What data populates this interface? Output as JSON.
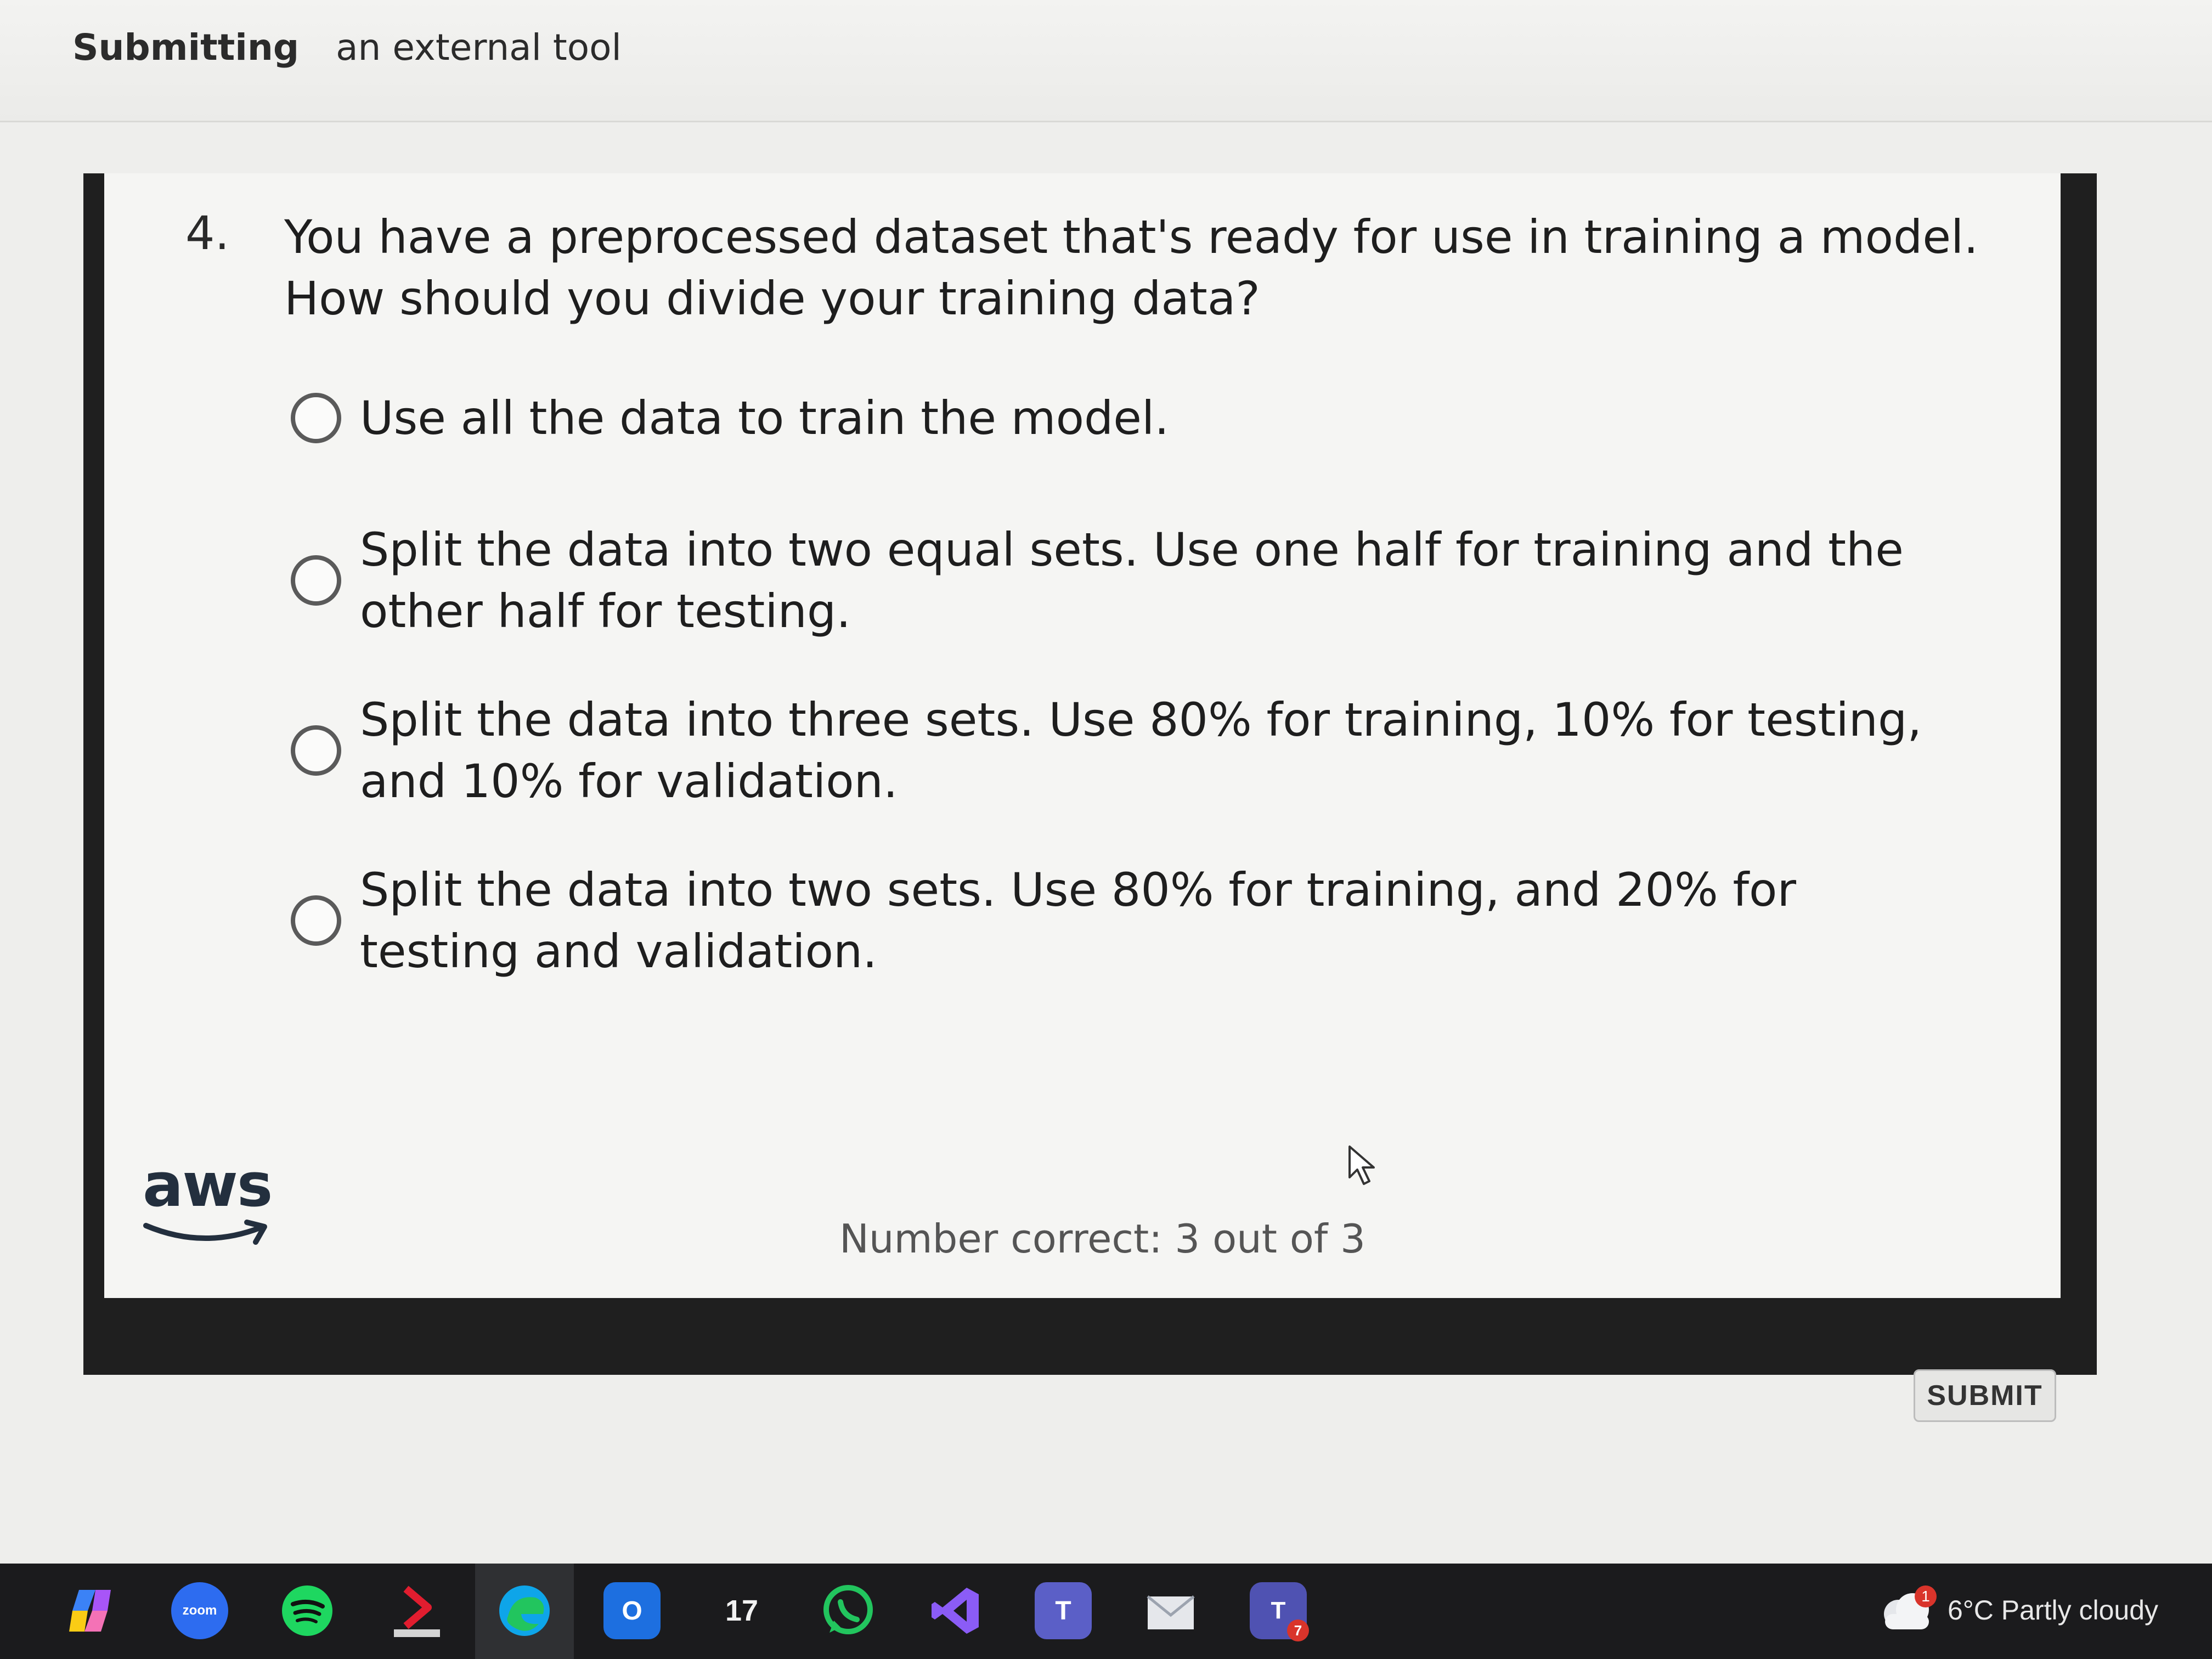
{
  "breadcrumb": {
    "current": "Submitting",
    "context": "an external tool"
  },
  "question": {
    "number": "4.",
    "text": "You have a preprocessed dataset that's ready for use in training a model. How should you divide your training data?"
  },
  "options": [
    {
      "label": "Use all the data to train the model.",
      "selected": false
    },
    {
      "label": "Split the data into two equal sets. Use one half for training and the other half for testing.",
      "selected": false
    },
    {
      "label": "Split the data into three sets. Use 80% for training, 10% for testing, and 10% for validation.",
      "selected": false
    },
    {
      "label": "Split the data into two sets. Use 80% for training, and 20% for testing and validation.",
      "selected": false
    }
  ],
  "branding": {
    "logo_text": "aws",
    "logo_color": "#232f3e",
    "smile_color": "#232f3e"
  },
  "score": {
    "text": "Number correct: 3 out of 3"
  },
  "submit": {
    "label": "SUBMIT"
  },
  "taskbar": {
    "apps": [
      {
        "name": "copilot-icon"
      },
      {
        "name": "zoom-icon",
        "label": "zoom"
      },
      {
        "name": "spotify-icon"
      },
      {
        "name": "pdf-reader-icon"
      },
      {
        "name": "edge-icon"
      },
      {
        "name": "outlook-icon",
        "label": "O"
      },
      {
        "name": "tradingview-icon",
        "label": "17"
      },
      {
        "name": "whatsapp-icon"
      },
      {
        "name": "visual-studio-icon"
      },
      {
        "name": "teams-icon",
        "label": "T"
      },
      {
        "name": "mail-icon"
      },
      {
        "name": "teams-classic-icon",
        "label": "T",
        "badge": "7"
      }
    ],
    "weather": {
      "text": "6°C  Partly cloudy",
      "badge": "1"
    }
  }
}
